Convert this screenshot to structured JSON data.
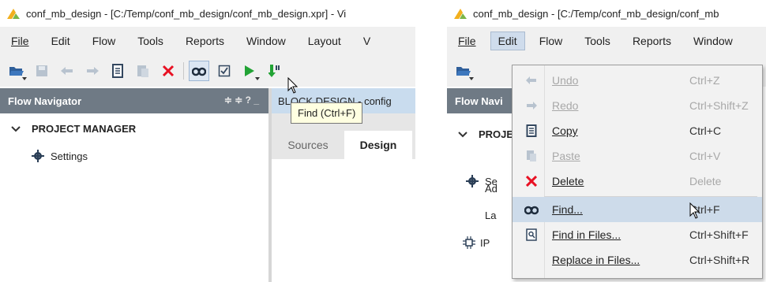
{
  "left": {
    "title": "conf_mb_design - [C:/Temp/conf_mb_design/conf_mb_design.xpr] - Vi",
    "menu": [
      "File",
      "Edit",
      "Flow",
      "Tools",
      "Reports",
      "Window",
      "Layout",
      "V"
    ],
    "toolbar_icons": [
      "open-project-icon",
      "save-icon",
      "undo-icon",
      "redo-icon",
      "copy-icon",
      "paste-icon",
      "delete-icon",
      "find-icon",
      "validate-icon",
      "run-icon",
      "run-synthesis-icon"
    ],
    "flow_navigator": {
      "title": "Flow Navigator",
      "icons": "≑ ≑ ? _"
    },
    "tree": {
      "section": "PROJECT MANAGER",
      "item": "Settings"
    },
    "block_design": "BLOCK DESIGN - config",
    "tabs": [
      "Sources",
      "Design"
    ],
    "tooltip": "Find (Ctrl+F)"
  },
  "right": {
    "title": "conf_mb_design - [C:/Temp/conf_mb_design/conf_mb",
    "menu": [
      "File",
      "Edit",
      "Flow",
      "Tools",
      "Reports",
      "Window"
    ],
    "flow_navigator_title": "Flow Navi",
    "tree_fragments": [
      "PROJE",
      "Se",
      "Ad",
      "La",
      "IP"
    ],
    "edit_menu": [
      {
        "label": "Undo",
        "shortcut": "Ctrl+Z",
        "enabled": false,
        "icon": "undo-icon"
      },
      {
        "label": "Redo",
        "shortcut": "Ctrl+Shift+Z",
        "enabled": false,
        "icon": "redo-icon"
      },
      {
        "label": "Copy",
        "shortcut": "Ctrl+C",
        "enabled": true,
        "icon": "copy-icon"
      },
      {
        "label": "Paste",
        "shortcut": "Ctrl+V",
        "enabled": false,
        "icon": "paste-icon"
      },
      {
        "label": "Delete",
        "shortcut": "Delete",
        "enabled": true,
        "icon": "delete-icon"
      },
      {
        "label": "Find...",
        "shortcut": "Ctrl+F",
        "enabled": true,
        "icon": "find-icon",
        "highlighted": true
      },
      {
        "label": "Find in Files...",
        "shortcut": "Ctrl+Shift+F",
        "enabled": true,
        "icon": "find-in-files-icon"
      },
      {
        "label": "Replace in Files...",
        "shortcut": "Ctrl+Shift+R",
        "enabled": true,
        "icon": ""
      }
    ]
  },
  "colors": {
    "accent_highlight": "#cddbea",
    "header_bg": "#6f7a85",
    "delete_red": "#e81123",
    "run_green": "#22a335",
    "logo": "#f2b01e"
  }
}
